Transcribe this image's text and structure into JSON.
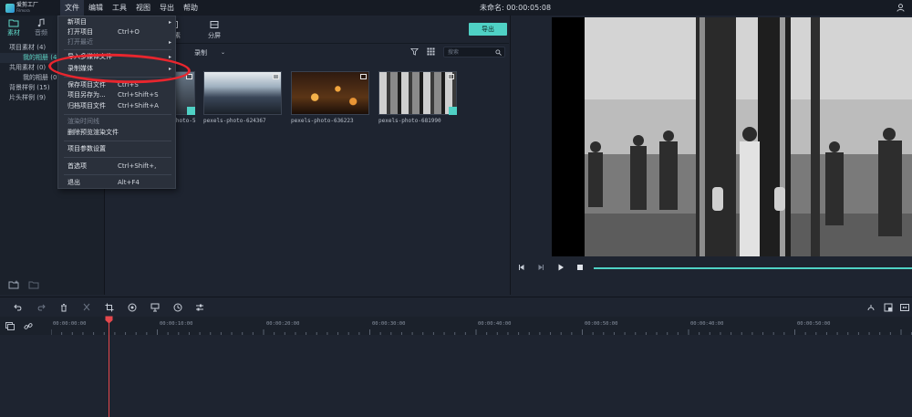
{
  "app": {
    "logo_text": "爱剪工厂",
    "logo_sub": "Filmora",
    "doc_title": "未命名: 00:00:05:08"
  },
  "menubar": [
    {
      "label": "文件",
      "active": true
    },
    {
      "label": "编辑"
    },
    {
      "label": "工具"
    },
    {
      "label": "视图"
    },
    {
      "label": "导出"
    },
    {
      "label": "帮助"
    }
  ],
  "file_menu": {
    "items": [
      {
        "label": "新项目",
        "shortcut": "",
        "submenu": true
      },
      {
        "label": "打开项目",
        "shortcut": "Ctrl+O"
      },
      {
        "label": "打开最近",
        "shortcut": "",
        "submenu": true,
        "disabled": true
      },
      {
        "label": "导入多媒体文件",
        "shortcut": "",
        "submenu": true
      },
      {
        "label": "录制媒体",
        "shortcut": "",
        "submenu": true
      },
      {
        "label": "保存项目文件",
        "shortcut": "Ctrl+S"
      },
      {
        "label": "项目另存为...",
        "shortcut": "Ctrl+Shift+S"
      },
      {
        "label": "归档项目文件",
        "shortcut": "Ctrl+Shift+A"
      },
      {
        "label": "渲染时间线",
        "shortcut": "",
        "disabled": true
      },
      {
        "label": "删除预览渲染文件",
        "shortcut": ""
      },
      {
        "label": "项目参数设置",
        "shortcut": ""
      },
      {
        "label": "首选项",
        "shortcut": "Ctrl+Shift+,"
      },
      {
        "label": "退出",
        "shortcut": "Alt+F4"
      }
    ]
  },
  "sidebar": {
    "tabs": [
      {
        "label": "素材",
        "icon": "folder-icon",
        "active": true
      },
      {
        "label": "音频",
        "icon": "music-icon"
      }
    ],
    "items": [
      {
        "label": "项目素材 (4)"
      },
      {
        "label": "我的相册 (4)",
        "sub": true,
        "selected": true
      },
      {
        "label": "共用素材 (0)"
      },
      {
        "label": "我的相册 (0)",
        "sub": true
      },
      {
        "label": "背景样例 (15)"
      },
      {
        "label": "片头样例 (9)"
      }
    ]
  },
  "media_tabs": [
    {
      "label": "元素",
      "icon": "element-icon"
    },
    {
      "label": "分屏",
      "icon": "split-icon"
    }
  ],
  "export_label": "导出",
  "filter": {
    "record_label": "录制",
    "search_placeholder": "搜索"
  },
  "thumbnails": [
    {
      "label": "pexels-photo-5"
    },
    {
      "label": "pexels-photo-624367"
    },
    {
      "label": "pexels-photo-636223"
    },
    {
      "label": "pexels-photo-681990"
    }
  ],
  "timeline": {
    "timecodes": [
      "00:00:00:00",
      "00:00:10:00",
      "00:00:20:00",
      "00:00:30:00",
      "00:00:40:00",
      "00:00:50:00",
      "00:00:40:00",
      "00:00:50:00"
    ]
  },
  "colors": {
    "accent": "#4fd1c5",
    "annotation": "#e8262e",
    "playhead": "#e5484d"
  }
}
